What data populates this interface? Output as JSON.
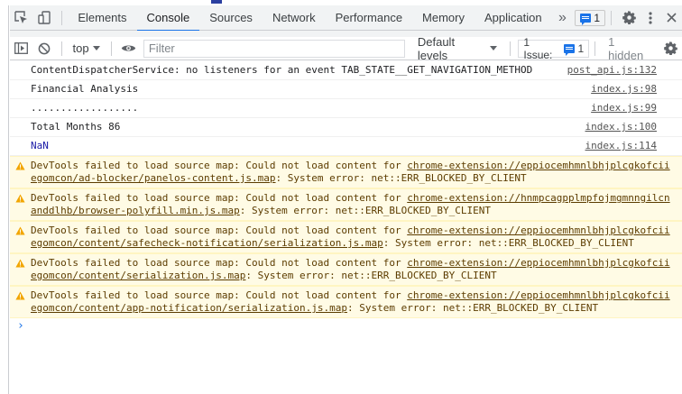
{
  "devtools": {
    "tabs": [
      "Elements",
      "Console",
      "Sources",
      "Network",
      "Performance",
      "Memory",
      "Application"
    ],
    "active_tab": "Console",
    "more_tabs_glyph": "»",
    "issues_badge_count": "1",
    "close_glyph": "×"
  },
  "console_toolbar": {
    "context": "top",
    "filter_placeholder": "Filter",
    "levels_label": "Default levels",
    "issues_label": "1 Issue:",
    "issues_count": "1",
    "hidden_label": "1 hidden"
  },
  "messages": [
    {
      "text": "ContentDispatcherService: no listeners for an event TAB_STATE__GET_NAVIGATION_METHOD",
      "source": "post_api.js:132"
    },
    {
      "text": "Financial Analysis",
      "source": "index.js:98"
    },
    {
      "text": "..................",
      "source": "index.js:99"
    },
    {
      "text": "Total Months 86",
      "source": "index.js:100"
    },
    {
      "text": "NaN",
      "source": "index.js:114",
      "color": "#1a1aa6"
    }
  ],
  "warnings": [
    {
      "prefix": "DevTools failed to load source map: Could not load content for ",
      "url": "chrome-extension://eppiocemhmnlbhjplcgkofciiegomcon/ad-blocker/panelos-content.js.map",
      "suffix": ": System error: net::ERR_BLOCKED_BY_CLIENT"
    },
    {
      "prefix": "DevTools failed to load source map: Could not load content for ",
      "url": "chrome-extension://hnmpcagpplmpfojmgmnngilcnanddlhb/browser-polyfill.min.js.map",
      "suffix": ": System error: net::ERR_BLOCKED_BY_CLIENT"
    },
    {
      "prefix": "DevTools failed to load source map: Could not load content for ",
      "url": "chrome-extension://eppiocemhmnlbhjplcgkofciiegomcon/content/safecheck-notification/serialization.js.map",
      "suffix": ": System error: net::ERR_BLOCKED_BY_CLIENT"
    },
    {
      "prefix": "DevTools failed to load source map: Could not load content for ",
      "url": "chrome-extension://eppiocemhmnlbhjplcgkofciiegomcon/content/serialization.js.map",
      "suffix": ": System error: net::ERR_BLOCKED_BY_CLIENT"
    },
    {
      "prefix": "DevTools failed to load source map: Could not load content for ",
      "url": "chrome-extension://eppiocemhmnlbhjplcgkofciiegomcon/content/app-notification/serialization.js.map",
      "suffix": ": System error: net::ERR_BLOCKED_BY_CLIENT"
    }
  ],
  "prompt_glyph": "›",
  "colors": {
    "accent": "#1a73e8",
    "warning_bg": "#fffbe5",
    "warning_text": "#5c3c00",
    "warning_icon": "#f2a600"
  },
  "icons": [
    "inspect-element-icon",
    "device-toolbar-icon",
    "sidebar-toggle-icon",
    "clear-console-icon",
    "eye-icon",
    "warning-icon",
    "gear-icon",
    "kebab-menu-icon",
    "close-icon"
  ]
}
